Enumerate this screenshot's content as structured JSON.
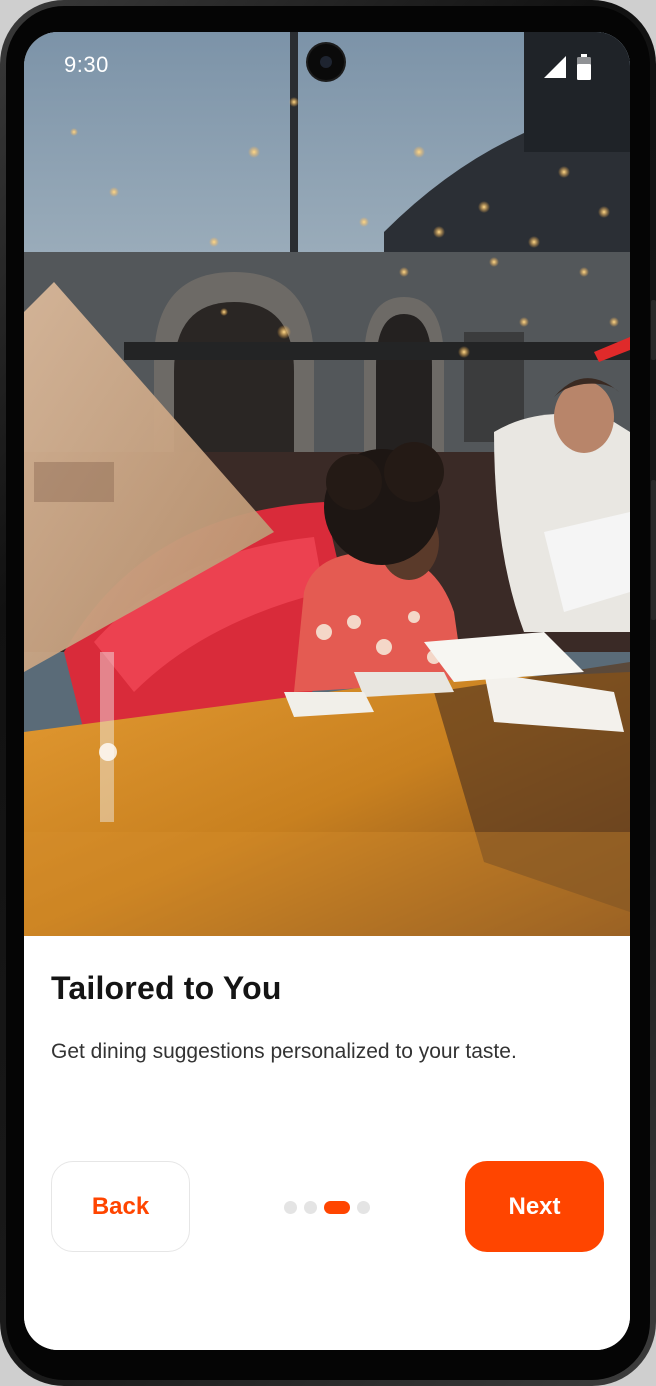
{
  "status_bar": {
    "time": "9:30",
    "signal_icon": "cellular-signal-icon",
    "battery_icon": "battery-icon"
  },
  "hero": {
    "image": "restaurant-diners-photo"
  },
  "onboarding": {
    "title": "Tailored to You",
    "description": "Get dining suggestions personalized to your taste.",
    "back_label": "Back",
    "next_label": "Next",
    "page_count": 4,
    "current_page": 3
  },
  "colors": {
    "accent": "#FF4500",
    "title_text": "#141414",
    "body_text": "#333333",
    "inactive_dot": "#e4e4e4"
  }
}
